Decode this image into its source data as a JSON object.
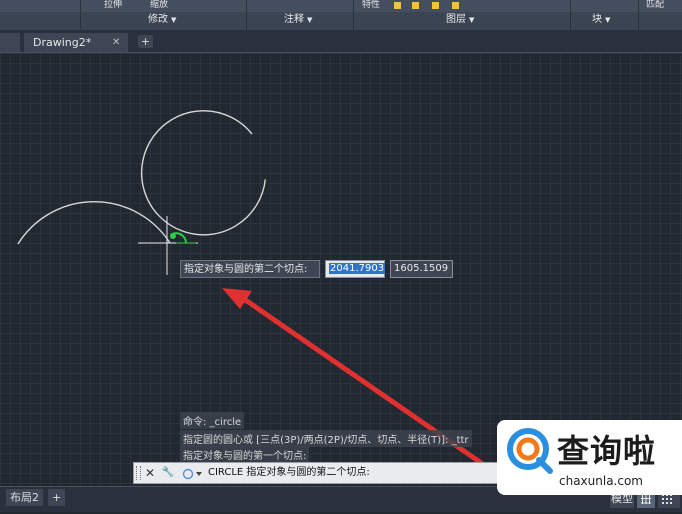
{
  "ribbon": {
    "panels": [
      {
        "label": "修改",
        "tiny": [
          "拉伸",
          "缩放"
        ]
      },
      {
        "label": "注释"
      },
      {
        "label": "图层",
        "tiny": [
          "特性"
        ]
      },
      {
        "label": "块"
      },
      {
        "label": "",
        "tiny": [
          "匹配"
        ]
      }
    ]
  },
  "tabs": {
    "drawing": "Drawing2*",
    "close": "✕",
    "new": "+"
  },
  "tooltip": {
    "prompt": "指定对象与圆的第二个切点:",
    "x_value": "2041.7903",
    "y_value": "1605.1509"
  },
  "history": [
    "命令: _circle",
    "指定圆的圆心或 [三点(3P)/两点(2P)/切点、切点、半径(T)]: _ttr",
    "指定对象与圆的第一个切点:"
  ],
  "command": {
    "text": "CIRCLE 指定对象与圆的第二个切点:",
    "close_icon": "✕",
    "settings_icon": "🔧"
  },
  "bottom": {
    "layout_tab": "布局2",
    "add_tab": "+",
    "model": "模型"
  },
  "watermark": {
    "name": "查询啦",
    "url": "chaxunla.com"
  },
  "colors": {
    "ribbon": "#3b4453",
    "canvas": "#212830",
    "arrow": "#e03030",
    "selection": "#3074c8"
  }
}
